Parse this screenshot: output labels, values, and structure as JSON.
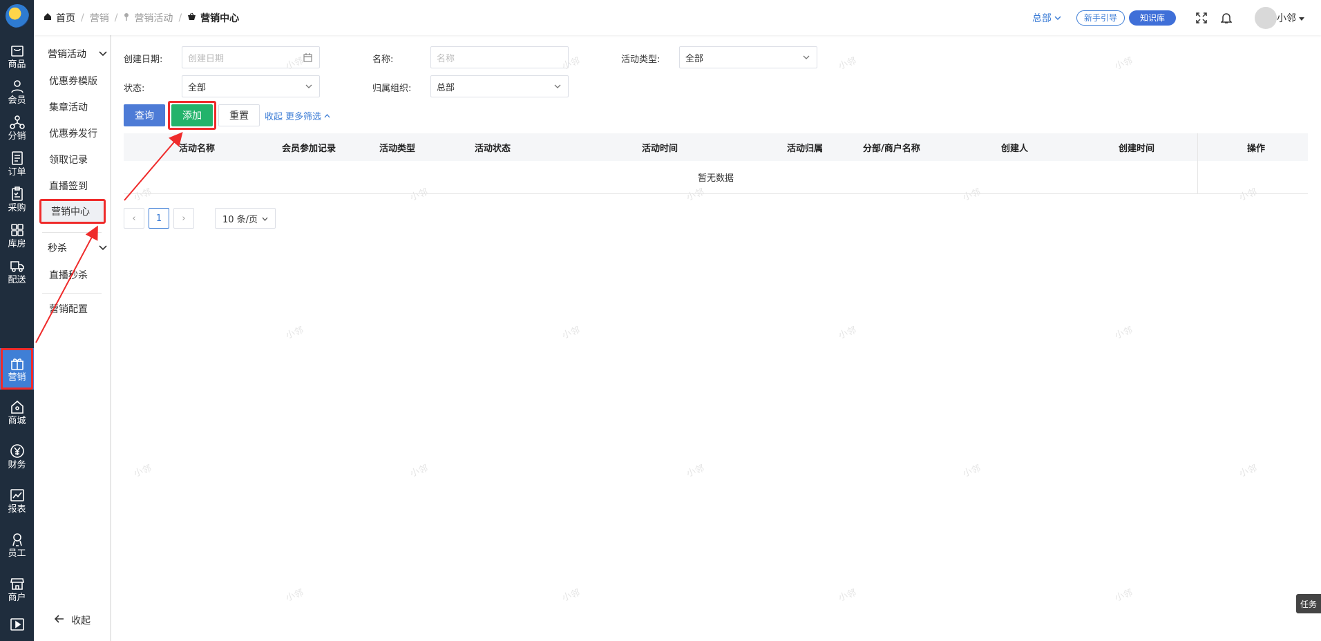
{
  "rail": {
    "items": [
      {
        "label": "商品",
        "icon": "bag-icon"
      },
      {
        "label": "会员",
        "icon": "user-icon"
      },
      {
        "label": "分销",
        "icon": "network-icon"
      },
      {
        "label": "订单",
        "icon": "document-icon"
      },
      {
        "label": "采购",
        "icon": "clipboard-icon"
      },
      {
        "label": "库房",
        "icon": "grid-icon"
      },
      {
        "label": "配送",
        "icon": "truck-icon"
      },
      {
        "label": "营销",
        "icon": "gift-icon"
      },
      {
        "label": "商城",
        "icon": "home-icon"
      },
      {
        "label": "财务",
        "icon": "yen-icon"
      },
      {
        "label": "报表",
        "icon": "chart-icon"
      },
      {
        "label": "员工",
        "icon": "employee-icon"
      },
      {
        "label": "商户",
        "icon": "shop-icon"
      },
      {
        "label": "",
        "icon": "play-icon"
      }
    ],
    "active_index": 7
  },
  "submenu": {
    "group1": "营销活动",
    "items1": [
      "优惠券模版",
      "集章活动",
      "优惠券发行",
      "领取记录",
      "直播签到",
      "营销中心"
    ],
    "group2": "秒杀",
    "items2": [
      "直播秒杀"
    ],
    "config": "营销配置",
    "collapse": "收起"
  },
  "breadcrumb": {
    "home": "首页",
    "level1": "营销",
    "level2": "营销活动",
    "current": "营销中心"
  },
  "topbar": {
    "org": "总部",
    "guide": "新手引导",
    "kb": "知识库",
    "user": "小邻"
  },
  "filters": {
    "create_date_label": "创建日期:",
    "create_date_placeholder": "创建日期",
    "name_label": "名称:",
    "name_placeholder": "名称",
    "type_label": "活动类型:",
    "type_value": "全部",
    "status_label": "状态:",
    "status_value": "全部",
    "org_label": "归属组织:",
    "org_value": "总部"
  },
  "actions": {
    "query": "查询",
    "add": "添加",
    "reset": "重置",
    "collapse": "收起",
    "more": "更多筛选"
  },
  "table": {
    "columns": [
      "活动名称",
      "会员参加记录",
      "活动类型",
      "活动状态",
      "活动时间",
      "活动归属",
      "分部/商户名称",
      "创建人",
      "创建时间",
      "操作"
    ],
    "empty": "暂无数据"
  },
  "pager": {
    "page": "1",
    "size": "10 条/页"
  },
  "task": "任务",
  "watermark": "小邻",
  "colors": {
    "rail_bg": "#1f2d3d",
    "accent": "#4d7bd6",
    "add": "#23b36b",
    "highlight": "#ef2b2b"
  }
}
